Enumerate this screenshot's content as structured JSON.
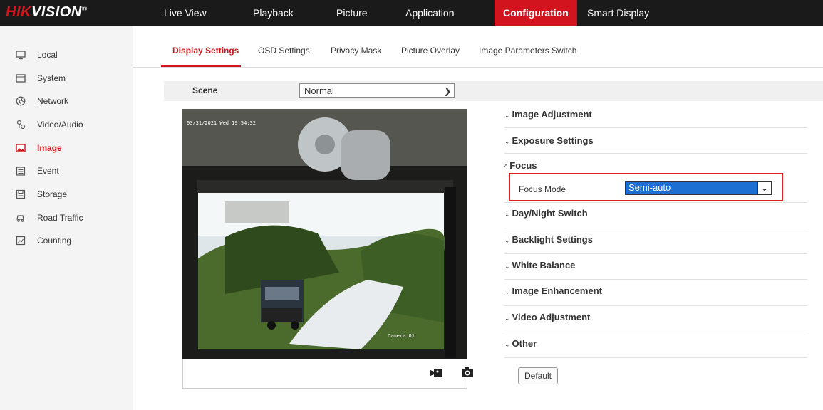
{
  "brand": {
    "logo_red": "HIK",
    "logo_white": "VISION",
    "reg": "®"
  },
  "nav": {
    "items": [
      "Live View",
      "Playback",
      "Picture",
      "Application",
      "Configuration",
      "Smart Display"
    ],
    "active": "Configuration"
  },
  "sidebar": {
    "items": [
      {
        "label": "Local",
        "icon": "monitor-icon"
      },
      {
        "label": "System",
        "icon": "system-icon"
      },
      {
        "label": "Network",
        "icon": "globe-icon"
      },
      {
        "label": "Video/Audio",
        "icon": "video-audio-icon"
      },
      {
        "label": "Image",
        "icon": "image-icon"
      },
      {
        "label": "Event",
        "icon": "calendar-icon"
      },
      {
        "label": "Storage",
        "icon": "storage-icon"
      },
      {
        "label": "Road Traffic",
        "icon": "car-icon"
      },
      {
        "label": "Counting",
        "icon": "counting-icon"
      }
    ],
    "active": "Image"
  },
  "tabs": {
    "items": [
      "Display Settings",
      "OSD Settings",
      "Privacy Mask",
      "Picture Overlay",
      "Image Parameters Switch"
    ],
    "active": "Display Settings"
  },
  "scene": {
    "label": "Scene",
    "value": "Normal"
  },
  "video": {
    "timestamp": "03/31/2021 Wed 19:54:32",
    "camera_label": "Camera 01"
  },
  "sections": {
    "image_adjustment": "Image Adjustment",
    "exposure_settings": "Exposure Settings",
    "focus": "Focus",
    "focus_mode_label": "Focus Mode",
    "focus_mode_value": "Semi-auto",
    "day_night": "Day/Night Switch",
    "backlight": "Backlight Settings",
    "white_balance": "White Balance",
    "image_enhancement": "Image Enhancement",
    "video_adjustment": "Video Adjustment",
    "other": "Other"
  },
  "default_button": "Default",
  "colors": {
    "accent": "#d2141f",
    "highlight_box": "#e02020",
    "select_blue": "#1e6fd2",
    "topbar": "#1a1a1a"
  }
}
